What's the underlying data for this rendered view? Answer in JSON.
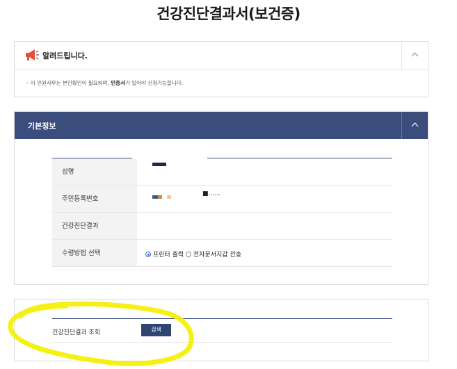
{
  "page": {
    "title": "건강진단결과서(보건증)"
  },
  "notice": {
    "title": "알려드립니다.",
    "text_prefix": "◦ 이 민원사무는 본인확인이 필요하며, ",
    "text_bold": "인증서",
    "text_suffix": "가 있어야 신청가능합니다."
  },
  "basic_info": {
    "title": "기본정보",
    "rows": [
      {
        "label": "성명"
      },
      {
        "label": "주민등록번호",
        "masked_suffix": "■......"
      },
      {
        "label": "건강진단결과"
      },
      {
        "label": "수령방법 선택"
      }
    ],
    "receive_options": [
      {
        "label": "프린터 출력",
        "selected": true
      },
      {
        "label": "전자문서지갑 전송",
        "selected": false
      }
    ]
  },
  "search": {
    "label": "건강진단결과 조회",
    "button_label": "검색"
  },
  "colors": {
    "header_bg": "#3a4d7d",
    "button_bg": "#2e4574",
    "highlight": "#f4f000"
  }
}
